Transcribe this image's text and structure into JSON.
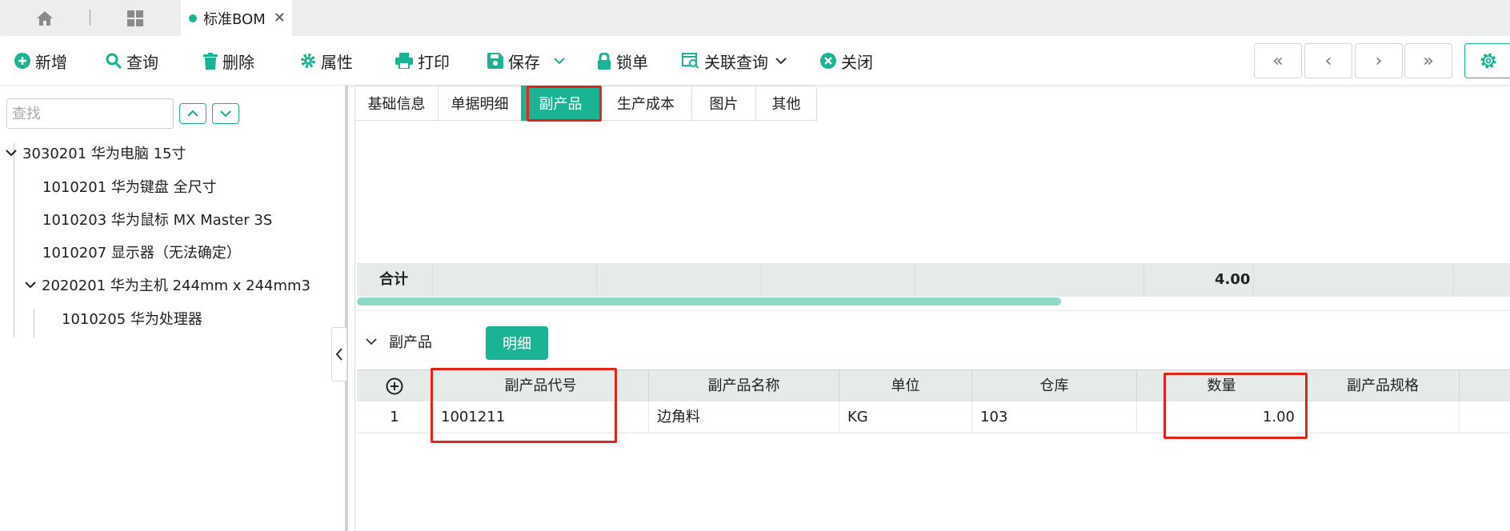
{
  "tabbar": {
    "doc_tab_label": "标准BOM",
    "close_glyph": "✕"
  },
  "toolbar": {
    "add": "新增",
    "query": "查询",
    "delete": "删除",
    "properties": "属性",
    "print": "打印",
    "save": "保存",
    "lock": "锁单",
    "related_query": "关联查询",
    "close": "关闭",
    "nav": {
      "first": "«",
      "prev": "‹",
      "next": "›",
      "last": "»"
    }
  },
  "sidebar": {
    "search_placeholder": "查找",
    "tree": [
      {
        "label": "3030201 华为电脑 15寸"
      },
      {
        "label": "1010201 华为键盘 全尺寸"
      },
      {
        "label": "1010203 华为鼠标 MX Master 3S"
      },
      {
        "label": "1010207 显示器（无法确定）"
      },
      {
        "label": "2020201 华为主机 244mm x 244mm3"
      },
      {
        "label": "1010205 华为处理器"
      }
    ]
  },
  "tabs": [
    "基础信息",
    "单据明细",
    "副产品",
    "生产成本",
    "图片",
    "其他"
  ],
  "summary": {
    "label": "合计",
    "total": "4.00"
  },
  "byproduct": {
    "section_title": "副产品",
    "detail_button": "明细",
    "columns": [
      "副产品代号",
      "副产品名称",
      "单位",
      "仓库",
      "数量",
      "副产品规格"
    ],
    "rows": [
      {
        "index": "1",
        "code": "1001211",
        "name": "边角料",
        "unit": "KG",
        "warehouse": "103",
        "qty": "1.00",
        "spec": ""
      }
    ]
  },
  "colors": {
    "accent": "#1ab394",
    "highlight": "#e5231b",
    "grid_header": "#e6ebea"
  }
}
